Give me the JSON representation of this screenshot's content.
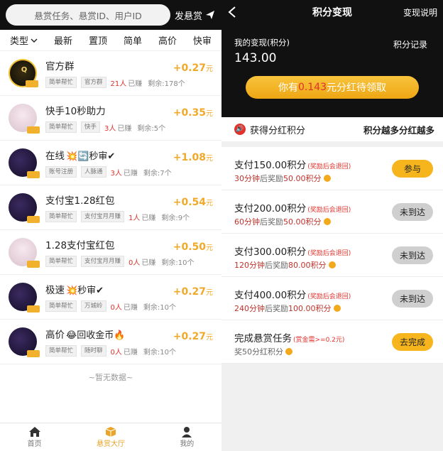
{
  "left": {
    "search_placeholder": "悬赏任务、悬赏ID、用户ID",
    "post_label": "发悬赏",
    "filters": [
      "类型",
      "最新",
      "置顶",
      "简单",
      "高价",
      "快审"
    ],
    "tasks": [
      {
        "title": "官方群",
        "emoji": "",
        "tags": [
          "简单帮忙",
          "官方群"
        ],
        "count": "21人",
        "count_label": "已赚",
        "remain": "剩余:178个",
        "price": "+0.27",
        "unit": "元",
        "avatar_text": "Q"
      },
      {
        "title": "快手10秒助力",
        "emoji": "",
        "tags": [
          "简单帮忙",
          "快手"
        ],
        "count": "3人",
        "count_label": "已赚",
        "remain": "剩余:5个",
        "price": "+0.35",
        "unit": "元",
        "avatar_text": ""
      },
      {
        "title": "在线",
        "emoji": "💥🔄秒审✔",
        "tags": [
          "账号注册",
          "人脉通"
        ],
        "count": "3人",
        "count_label": "已赚",
        "remain": "剩余:7个",
        "price": "+1.08",
        "unit": "元",
        "avatar_text": ""
      },
      {
        "title": "支付宝1.28红包",
        "emoji": "",
        "tags": [
          "简单帮忙",
          "支付宝月月赚"
        ],
        "count": "1人",
        "count_label": "已赚",
        "remain": "剩余:9个",
        "price": "+0.54",
        "unit": "元",
        "avatar_text": ""
      },
      {
        "title": "1.28支付宝红包",
        "emoji": "",
        "tags": [
          "简单帮忙",
          "支付宝月月赚"
        ],
        "count": "0人",
        "count_label": "已赚",
        "remain": "剩余:10个",
        "price": "+0.50",
        "unit": "元",
        "avatar_text": ""
      },
      {
        "title": "极速",
        "emoji": "💥秒审✔",
        "tags": [
          "简单帮忙",
          "万城岭"
        ],
        "count": "0人",
        "count_label": "已赚",
        "remain": "剩余:10个",
        "price": "+0.27",
        "unit": "元",
        "avatar_text": ""
      },
      {
        "title": "高价",
        "emoji": "😂回收金币🔥",
        "tags": [
          "简单帮忙",
          "随时聊"
        ],
        "count": "0人",
        "count_label": "已赚",
        "remain": "剩余:10个",
        "price": "+0.27",
        "unit": "元",
        "avatar_text": ""
      }
    ],
    "no_more": "~暂无数据~",
    "nav": [
      "首页",
      "悬赏大厅",
      "我的"
    ]
  },
  "right": {
    "title": "积分变现",
    "help": "变现说明",
    "my_label": "我的变现(积分)",
    "record": "积分记录",
    "value": "143.00",
    "banner_prefix": "你有",
    "banner_amount": "0.143",
    "banner_suffix": "元分红待领取",
    "dividend_title": "获得分红积分",
    "dividend_more": "积分越多分红越多",
    "rules": [
      {
        "line1": "支付150.00积分",
        "note": "(奖励后会退回)",
        "line2_a": "30分钟",
        "line2_b": "后奖励",
        "line2_c": "50.00积分",
        "button": "参与",
        "enabled": true
      },
      {
        "line1": "支付200.00积分",
        "note": "(奖励后会退回)",
        "line2_a": "60分钟",
        "line2_b": "后奖励",
        "line2_c": "50.00积分",
        "button": "未到达",
        "enabled": false
      },
      {
        "line1": "支付300.00积分",
        "note": "(奖励后会退回)",
        "line2_a": "120分钟",
        "line2_b": "后奖励",
        "line2_c": "80.00积分",
        "button": "未到达",
        "enabled": false
      },
      {
        "line1": "支付400.00积分",
        "note": "(奖励后会退回)",
        "line2_a": "240分钟",
        "line2_b": "后奖励",
        "line2_c": "100.00积分",
        "button": "未到达",
        "enabled": false
      },
      {
        "line1": "完成悬赏任务",
        "note": "(赏金需>=0.2元)",
        "line2_a": "",
        "line2_b": "奖50分红积分",
        "line2_c": "",
        "button": "去完成",
        "enabled": true
      }
    ]
  }
}
